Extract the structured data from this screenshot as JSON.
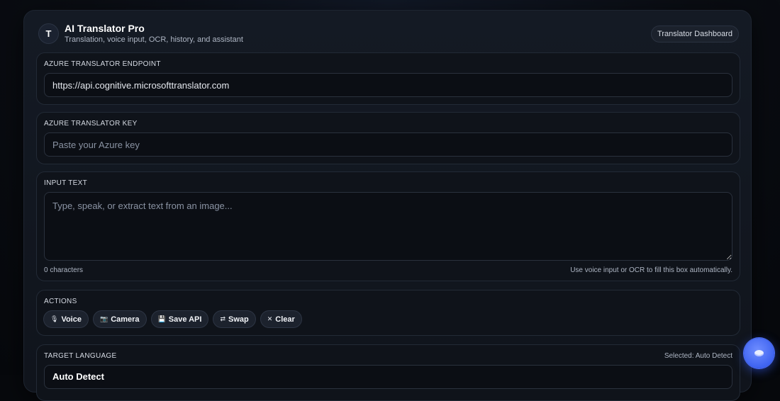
{
  "header": {
    "logo_letter": "T",
    "title": "AI Translator Pro",
    "subtitle": "Translation, voice input, OCR, history, and assistant",
    "dashboard_label": "Translator Dashboard"
  },
  "endpoint": {
    "label": "AZURE TRANSLATOR ENDPOINT",
    "value": "https://api.cognitive.microsofttranslator.com",
    "placeholder": ""
  },
  "key": {
    "label": "AZURE TRANSLATOR KEY",
    "value": "",
    "placeholder": "Paste your Azure key"
  },
  "input_text": {
    "label": "INPUT TEXT",
    "value": "",
    "placeholder": "Type, speak, or extract text from an image...",
    "char_count": "0 characters",
    "hint": "Use voice input or OCR to fill this box automatically."
  },
  "actions": {
    "label": "ACTIONS",
    "buttons": [
      {
        "icon": "microphone-icon",
        "glyph": "🎙",
        "label": "Voice"
      },
      {
        "icon": "camera-icon",
        "glyph": "📷",
        "label": "Camera"
      },
      {
        "icon": "floppy-disk-icon",
        "glyph": "💾",
        "label": "Save API"
      },
      {
        "icon": "swap-arrows-icon",
        "glyph": "⇄",
        "label": "Swap"
      },
      {
        "icon": "close-icon",
        "glyph": "✕",
        "label": "Clear"
      }
    ]
  },
  "target_language": {
    "label": "TARGET LANGUAGE",
    "selected_note": "Selected: Auto Detect",
    "value": "Auto Detect"
  },
  "assistant": {
    "icon": "chat-bubble-icon"
  },
  "colors": {
    "accent": "#3e63f0",
    "background": "#07090d",
    "panel": "#0f131a"
  }
}
